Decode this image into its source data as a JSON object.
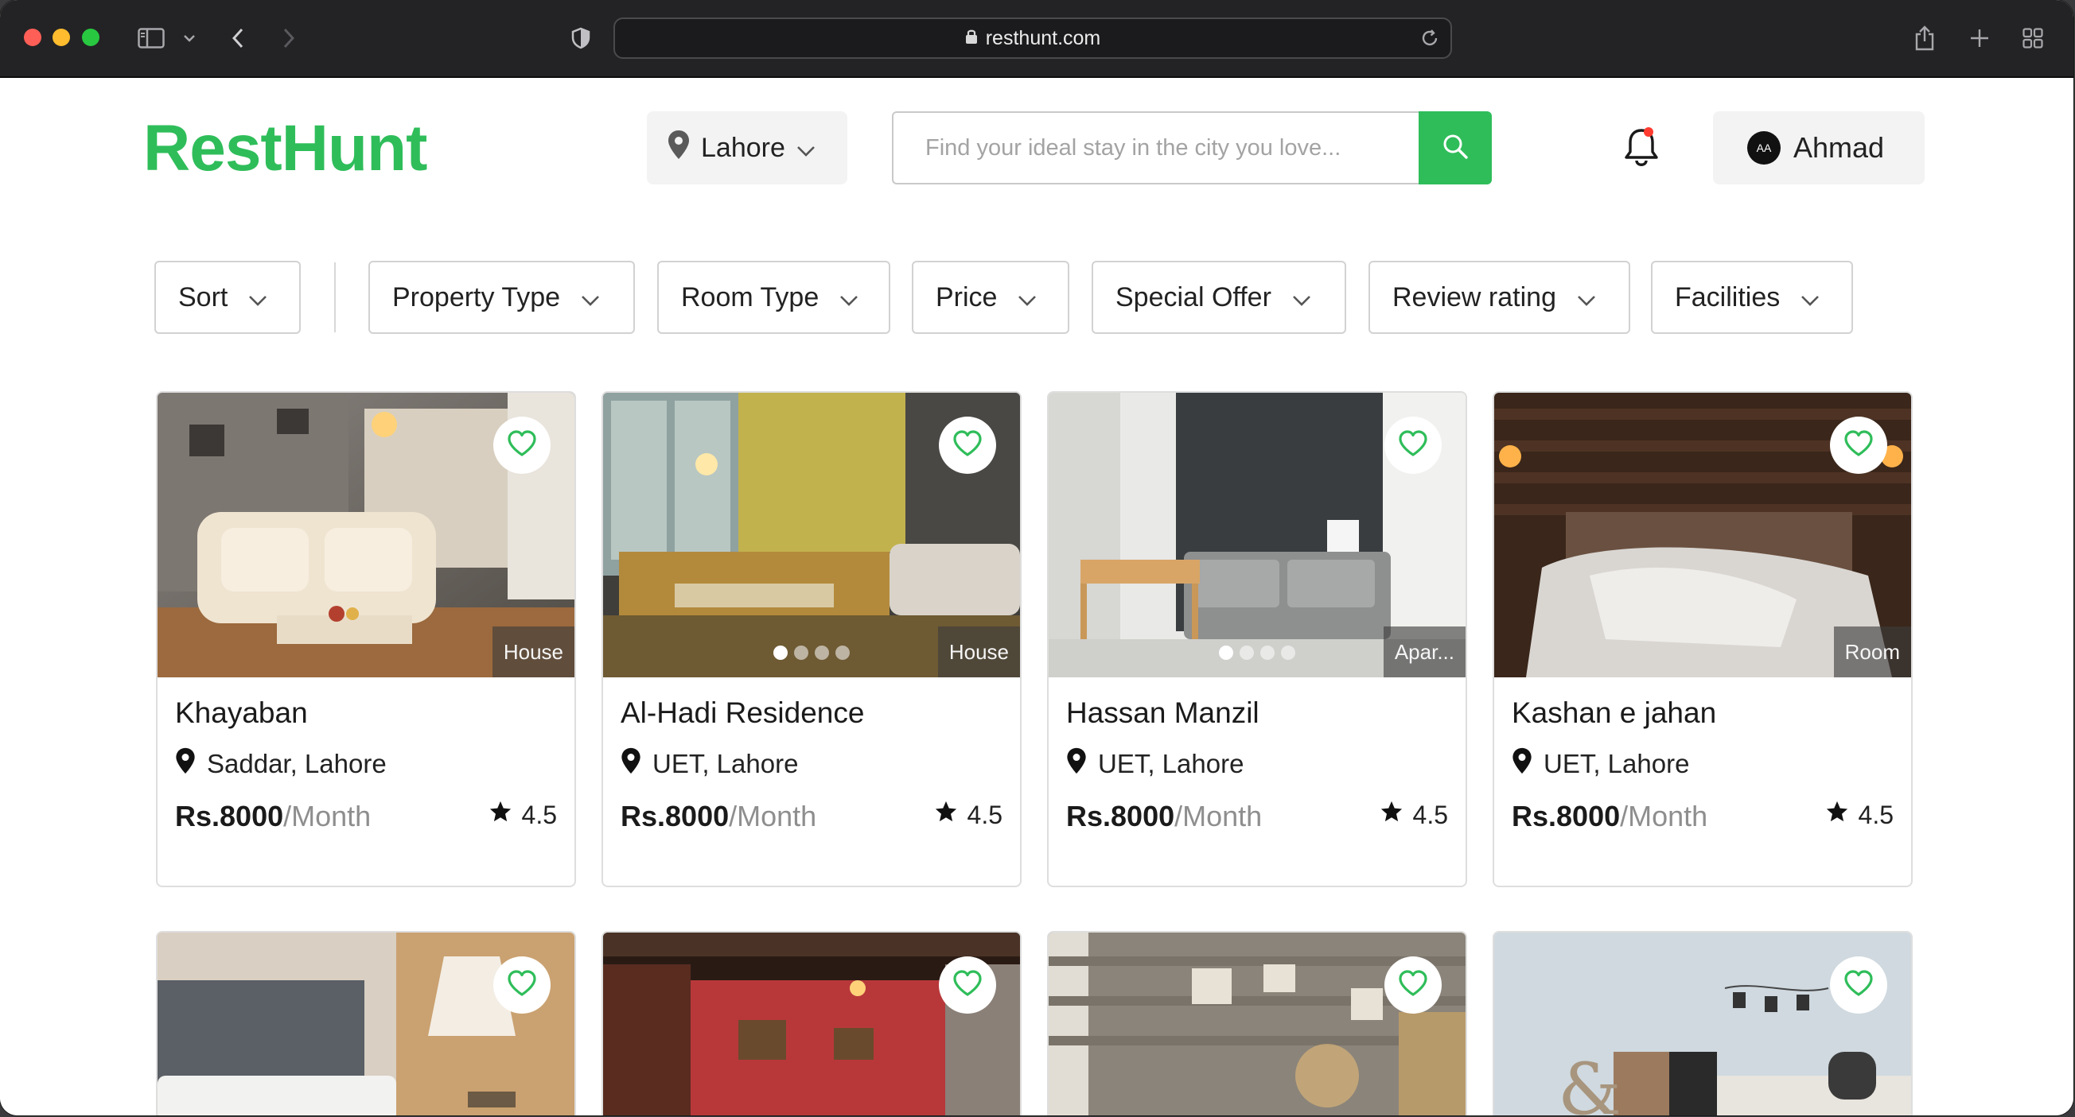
{
  "browser": {
    "url": "resthunt.com"
  },
  "header": {
    "logo": "RestHunt",
    "city": "Lahore",
    "search_placeholder": "Find your ideal stay in the city you love...",
    "user_initials": "AA",
    "user_name": "Ahmad"
  },
  "filters": [
    "Sort",
    "Property Type",
    "Room Type",
    "Price",
    "Special Offer",
    "Review rating",
    "Facilities"
  ],
  "listings": [
    {
      "name": "Khayaban",
      "location": "Saddar, Lahore",
      "price": "Rs.8000",
      "period": "/Month",
      "rating": "4.5",
      "type": "House"
    },
    {
      "name": "Al-Hadi Residence",
      "location": "UET, Lahore",
      "price": "Rs.8000",
      "period": "/Month",
      "rating": "4.5",
      "type": "House"
    },
    {
      "name": "Hassan Manzil",
      "location": "UET, Lahore",
      "price": "Rs.8000",
      "period": "/Month",
      "rating": "4.5",
      "type": "Apar..."
    },
    {
      "name": "Kashan e jahan",
      "location": "UET, Lahore",
      "price": "Rs.8000",
      "period": "/Month",
      "rating": "4.5",
      "type": "Room"
    }
  ],
  "colors": {
    "brand": "#2fbd5a",
    "toolbar": "#232325"
  },
  "icons": {
    "fav": "heart-outline-icon",
    "location": "map-pin-icon",
    "rating": "star-icon",
    "search": "search-icon",
    "notification": "bell-icon"
  }
}
